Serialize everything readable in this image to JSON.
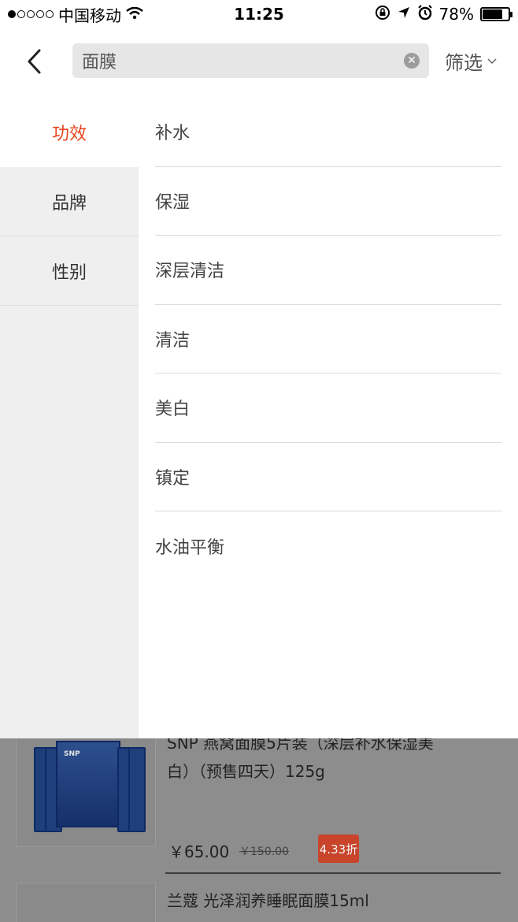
{
  "status_bar": {
    "carrier": "中国移动",
    "time": "11:25",
    "battery": "78%",
    "battery_level": 0.78
  },
  "header": {
    "back_icon": "chevron-left-icon",
    "search_value": "面膜",
    "clear_icon": "clear-icon",
    "filter_label": "筛选",
    "filter_icon": "chevron-down-icon"
  },
  "filter_panel": {
    "categories": [
      {
        "label": "功效",
        "active": true
      },
      {
        "label": "品牌",
        "active": false
      },
      {
        "label": "性别",
        "active": false
      }
    ],
    "options": [
      "补水",
      "保湿",
      "深层清洁",
      "清洁",
      "美白",
      "镇定",
      "水油平衡"
    ],
    "accent_color": "#e8451e"
  },
  "products": [
    {
      "title_line1": "SNP 燕窝面膜5片装（深层补水保湿美",
      "title_line2": "白）（预售四天）125g",
      "price": "￥65.00",
      "original_price": "￥150.00",
      "discount": "4.33折",
      "image_brand": "SNP"
    },
    {
      "title": "兰蔻 光泽润养睡眠面膜15ml"
    }
  ]
}
